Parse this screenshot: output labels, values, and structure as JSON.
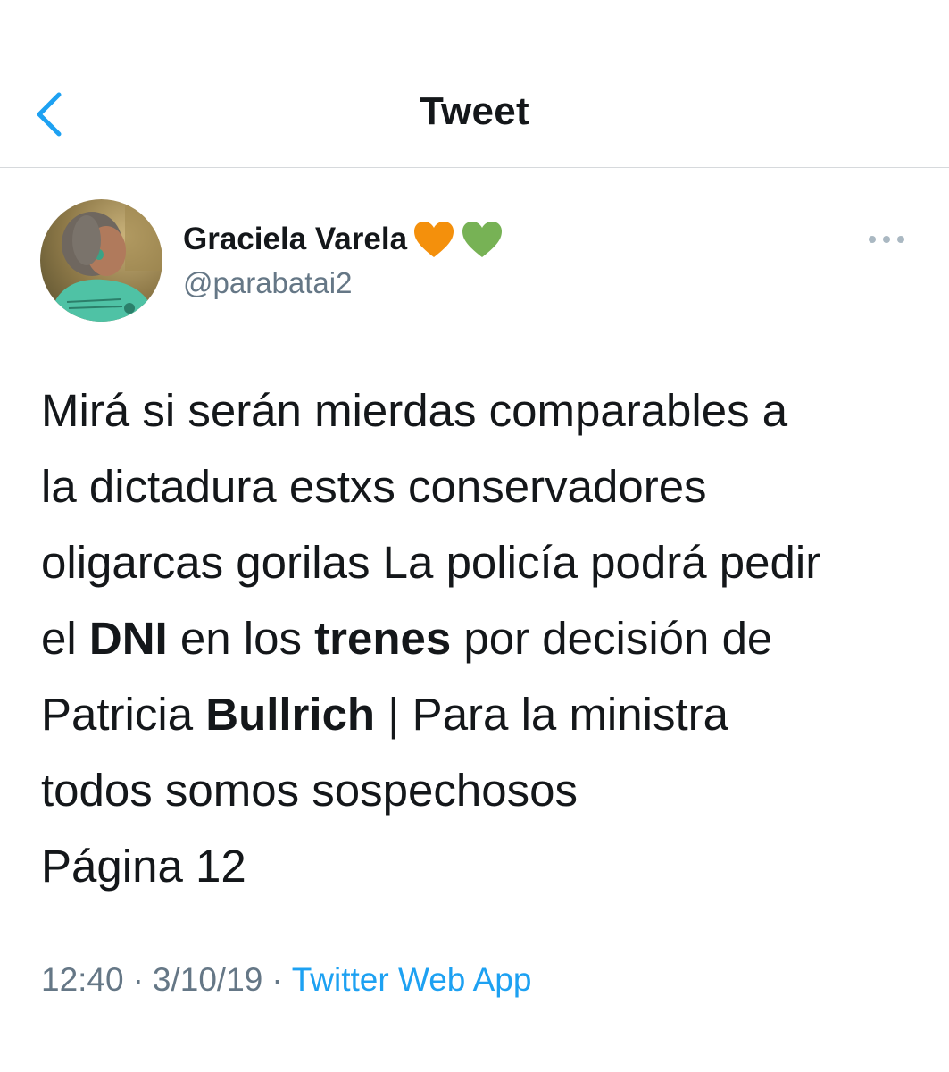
{
  "header": {
    "title": "Tweet",
    "back_icon": "chevron-left-icon",
    "accent_color": "#1da1f2"
  },
  "tweet": {
    "author": {
      "display_name": "Graciela Varela",
      "emojis": [
        "orange-heart-icon",
        "green-heart-icon"
      ],
      "handle": "@parabatai2"
    },
    "more_icon": "more-dots-icon",
    "text_lines": [
      [
        {
          "text": "Mirá si serán mierdas comparables a"
        }
      ],
      [
        {
          "text": "la dictadura estxs conservadores"
        }
      ],
      [
        {
          "text": "oligarcas gorilas La policía podrá pedir"
        }
      ],
      [
        {
          "text": "el "
        },
        {
          "text": "DNI",
          "bold": true
        },
        {
          "text": " en los "
        },
        {
          "text": "trenes",
          "bold": true
        },
        {
          "text": " por decisión de"
        }
      ],
      [
        {
          "text": "Patricia "
        },
        {
          "text": "Bullrich",
          "bold": true
        },
        {
          "text": " | Para la ministra"
        }
      ],
      [
        {
          "text": "todos somos sospechosos"
        }
      ],
      [
        {
          "text": "Página 12"
        }
      ]
    ],
    "meta": {
      "time": "12:40",
      "separator": "·",
      "date": "3/10/19",
      "source": "Twitter Web App"
    }
  },
  "colors": {
    "text": "#14171a",
    "muted": "#657786",
    "divider": "#d6d9dc",
    "orange_heart": "#f4900c",
    "green_heart": "#77b255"
  }
}
